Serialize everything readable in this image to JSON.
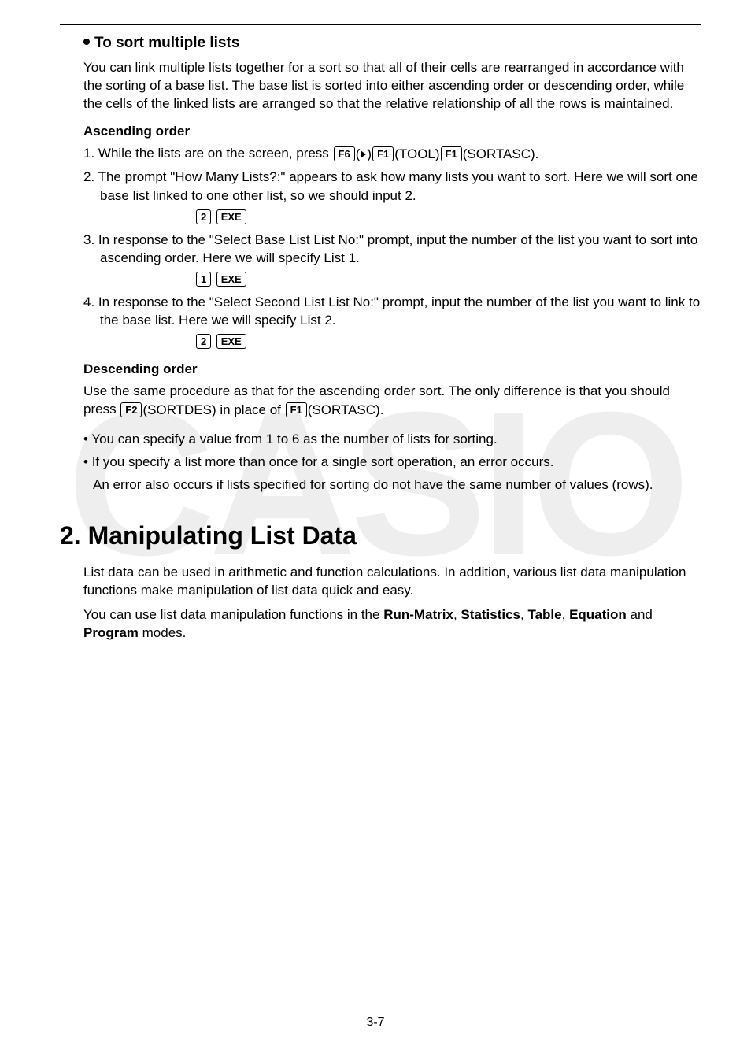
{
  "sub_heading": "To sort multiple lists",
  "intro_para": "You can link multiple lists together for a sort so that all of their cells are rearranged in accordance with the sorting of a base list. The base list is sorted into either ascending order or descending order, while the cells of the linked lists are arranged so that the relative relationship of all the rows is maintained.",
  "asc_heading": "Ascending order",
  "step1_a": "1. While the lists are on the screen, press ",
  "step1_b": "(TOOL)",
  "step1_c": "(SORTASC).",
  "keys": {
    "f6": "F6",
    "f1": "F1",
    "f2": "F2",
    "k2": "2",
    "exe": "EXE",
    "k1": "1",
    "tri_open": "(",
    "tri_close": ")"
  },
  "step2": "2. The prompt \"How Many Lists?:\" appears to ask how many lists you want to sort. Here we will sort one base list linked to one other list, so we should input 2.",
  "step3": "3. In response to the \"Select Base List List No:\" prompt, input the number of the list you want to sort into ascending order. Here we will specify List 1.",
  "step4": "4. In response to the \"Select Second List List No:\" prompt, input the number of the list you want to link to the base list. Here we will specify List 2.",
  "desc_heading": "Descending order",
  "desc_para_a": "Use the same procedure as that for the ascending order sort. The only difference is that you should press ",
  "desc_para_b": "(SORTDES) in place of ",
  "desc_para_c": "(SORTASC).",
  "bullet1": "You can specify a value from 1 to 6 as the number of lists for sorting.",
  "bullet2": "If you specify a list more than once for a single sort operation, an error occurs.",
  "after_bullet": "An error also occurs if lists specified for sorting do not have the same number of values (rows).",
  "h1": "2. Manipulating List Data",
  "main_para1": "List data can be used in arithmetic and function calculations. In addition, various list data manipulation functions make manipulation of list data quick and easy.",
  "main_para2_a": "You can use list data manipulation functions in the ",
  "main_para2_b": "Run-Matrix",
  "main_para2_c": ", ",
  "main_para2_d": "Statistics",
  "main_para2_e": ", ",
  "main_para2_f": "Table",
  "main_para2_g": ", ",
  "main_para2_h": "Equation",
  "main_para2_i": " and ",
  "main_para2_j": "Program",
  "main_para2_k": " modes.",
  "page_num": "3-7",
  "watermark": "CASIO"
}
